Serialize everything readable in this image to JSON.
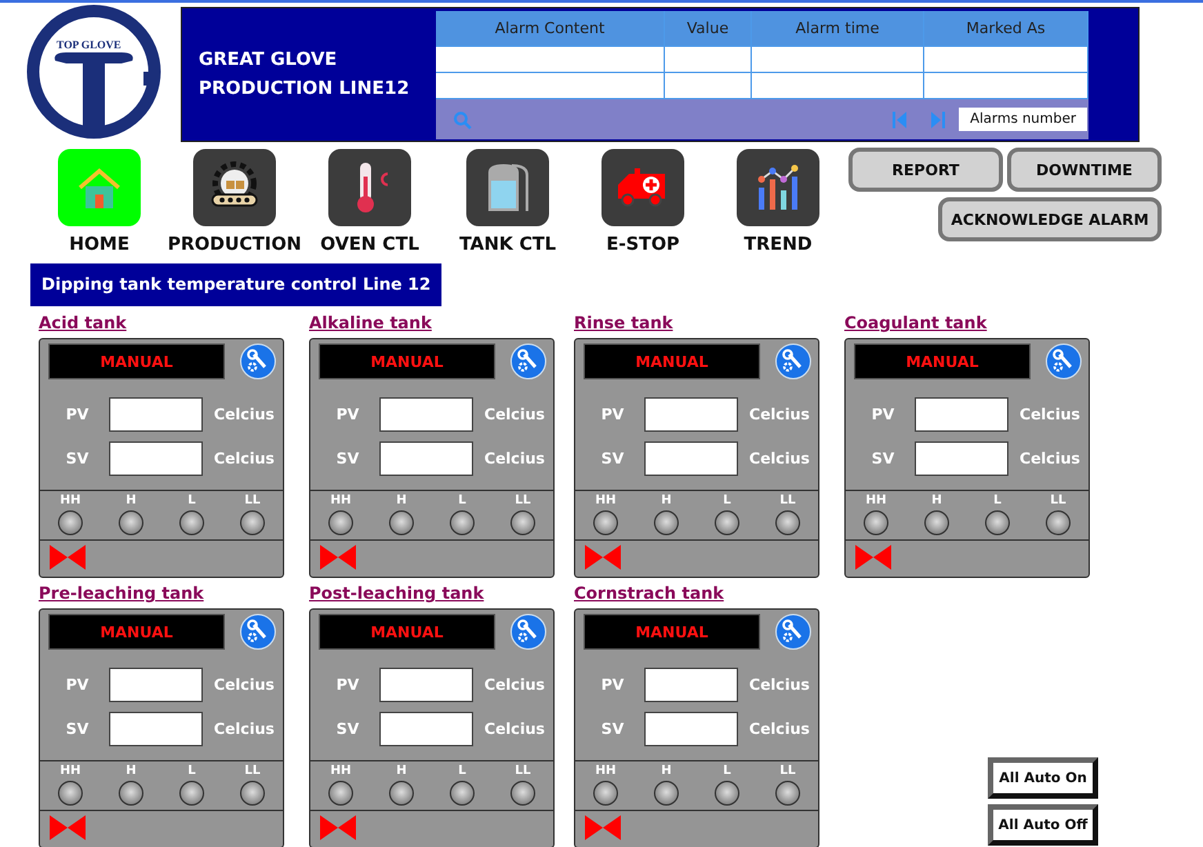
{
  "logo": {
    "text": "TOP GLOVE"
  },
  "header": {
    "title_lines": [
      "GREAT GLOVE",
      "PRODUCTION LINE12"
    ]
  },
  "alarm_table": {
    "columns": [
      "Alarm Content",
      "Value",
      "Alarm time",
      "Marked As"
    ],
    "alarms_number_label": "Alarms number"
  },
  "nav": [
    {
      "label": "HOME",
      "selected": true
    },
    {
      "label": "PRODUCTION",
      "selected": false
    },
    {
      "label": "OVEN CTL",
      "selected": false
    },
    {
      "label": "TANK CTL",
      "selected": false
    },
    {
      "label": "E-STOP",
      "selected": false
    },
    {
      "label": "TREND",
      "selected": false
    }
  ],
  "action_buttons": [
    "REPORT",
    "DOWNTIME",
    "ACKNOWLEDGE ALARM"
  ],
  "page_title": "Dipping tank temperature control Line 12",
  "tanks": [
    {
      "name": "Acid tank",
      "mode": "MANUAL",
      "pv_label": "PV",
      "sv_label": "SV",
      "pv_unit": "Celcius",
      "sv_unit": "Celcius",
      "alarms": [
        {
          "label": "HH",
          "on": false
        },
        {
          "label": "H",
          "on": false
        },
        {
          "label": "L",
          "on": false
        },
        {
          "label": "LL",
          "on": false
        }
      ],
      "valve_open": false
    },
    {
      "name": "Alkaline tank",
      "mode": "MANUAL",
      "pv_label": "PV",
      "sv_label": "SV",
      "pv_unit": "Celcius",
      "sv_unit": "Celcius",
      "alarms": [
        {
          "label": "HH",
          "on": false
        },
        {
          "label": "H",
          "on": false
        },
        {
          "label": "L",
          "on": false
        },
        {
          "label": "LL",
          "on": false
        }
      ],
      "valve_open": false
    },
    {
      "name": "Rinse tank",
      "mode": "MANUAL",
      "pv_label": "PV",
      "sv_label": "SV",
      "pv_unit": "Celcius",
      "sv_unit": "Celcius",
      "alarms": [
        {
          "label": "HH",
          "on": false
        },
        {
          "label": "H",
          "on": false
        },
        {
          "label": "L",
          "on": false
        },
        {
          "label": "LL",
          "on": false
        }
      ],
      "valve_open": false
    },
    {
      "name": "Coagulant tank",
      "mode": "MANUAL",
      "pv_label": "PV",
      "sv_label": "SV",
      "pv_unit": "Celcius",
      "sv_unit": "Celcius",
      "alarms": [
        {
          "label": "HH",
          "on": false
        },
        {
          "label": "H",
          "on": false
        },
        {
          "label": "L",
          "on": false
        },
        {
          "label": "LL",
          "on": false
        }
      ],
      "valve_open": false
    },
    {
      "name": "Pre-leaching tank",
      "mode": "MANUAL",
      "pv_label": "PV",
      "sv_label": "SV",
      "pv_unit": "Celcius",
      "sv_unit": "Celcius",
      "alarms": [
        {
          "label": "HH",
          "on": false
        },
        {
          "label": "H",
          "on": false
        },
        {
          "label": "L",
          "on": false
        },
        {
          "label": "LL",
          "on": false
        }
      ],
      "valve_open": false
    },
    {
      "name": "Post-leaching tank",
      "mode": "MANUAL",
      "pv_label": "PV",
      "sv_label": "SV",
      "pv_unit": "Celcius",
      "sv_unit": "Celcius",
      "alarms": [
        {
          "label": "HH",
          "on": false
        },
        {
          "label": "H",
          "on": false
        },
        {
          "label": "L",
          "on": false
        },
        {
          "label": "LL",
          "on": false
        }
      ],
      "valve_open": false
    },
    {
      "name": "Cornstrach tank",
      "mode": "MANUAL",
      "pv_label": "PV",
      "sv_label": "SV",
      "pv_unit": "Celcius",
      "sv_unit": "Celcius",
      "alarms": [
        {
          "label": "HH",
          "on": false
        },
        {
          "label": "H",
          "on": false
        },
        {
          "label": "L",
          "on": false
        },
        {
          "label": "LL",
          "on": false
        }
      ],
      "valve_open": false
    }
  ],
  "auto_buttons": [
    "All Auto On",
    "All Auto Off"
  ]
}
